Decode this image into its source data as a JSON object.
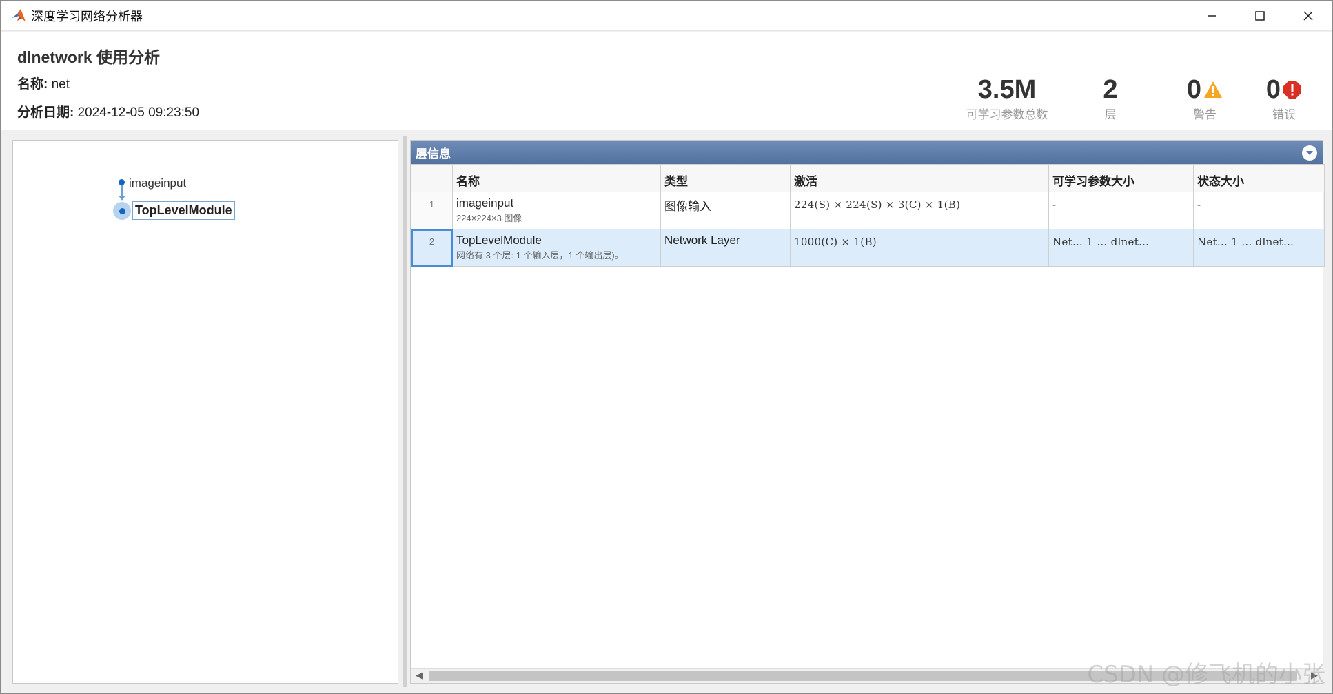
{
  "window": {
    "title": "深度学习网络分析器",
    "minimize": "minimize",
    "maximize": "maximize",
    "close": "close"
  },
  "header": {
    "title": "dlnetwork 使用分析",
    "name_label": "名称:",
    "name_value": "net",
    "date_label": "分析日期:",
    "date_value": "2024-12-05 09:23:50"
  },
  "stats": {
    "params_value": "3.5M",
    "params_label": "可学习参数总数",
    "layers_value": "2",
    "layers_label": "层",
    "warnings_value": "0",
    "warnings_label": "警告",
    "errors_value": "0",
    "errors_label": "错误",
    "warning_color": "#f5a623",
    "error_color": "#d93025"
  },
  "graph": {
    "node1_label": "imageinput",
    "node2_label": "TopLevelModule"
  },
  "layer_info": {
    "panel_title": "层信息",
    "columns": [
      "名称",
      "类型",
      "激活",
      "可学习参数大小",
      "状态大小"
    ],
    "rows": [
      {
        "index": "1",
        "name": "imageinput",
        "name_sub": "224×224×3 图像",
        "type": "图像输入",
        "activation": "224(S)  ×  224(S)  ×  3(C)  ×  1(B)",
        "learnables": "-",
        "states": "-"
      },
      {
        "index": "2",
        "name": "TopLevelModule",
        "name_sub": "网络有 3 个层: 1 个输入层，1 个输出层)。",
        "type": "Network Layer",
        "activation": "1000(C)  ×  1(B)",
        "learnables": "Net…   1 …   dlnet…",
        "states": "Net…   1 …   dlnet…"
      }
    ]
  },
  "watermark": "CSDN @修飞机的小张"
}
